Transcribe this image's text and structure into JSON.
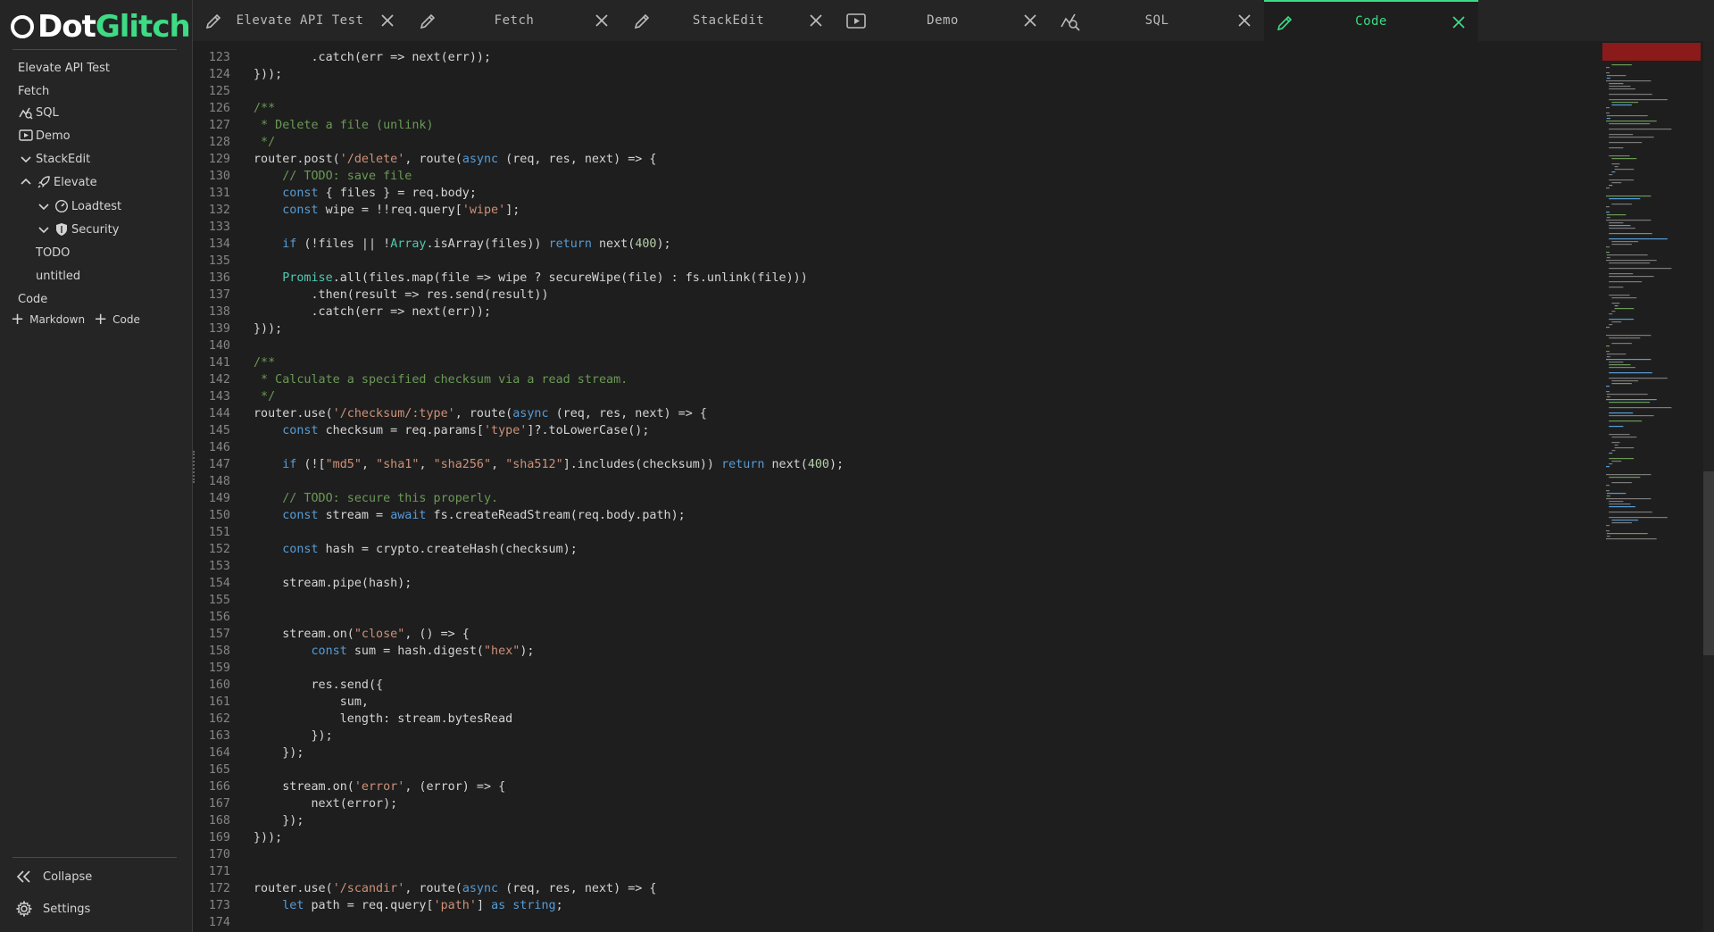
{
  "app": {
    "logo_part1": "Dot",
    "logo_part2": "Glitch"
  },
  "colors": {
    "accent": "#3ddc84",
    "background": "#1e1e1e",
    "sidebar": "#252526"
  },
  "sidebar": {
    "items": [
      {
        "label": "Elevate API Test",
        "icon": "none"
      },
      {
        "label": "Fetch",
        "icon": "none"
      },
      {
        "label": "SQL",
        "icon": "sql-graph-icon"
      },
      {
        "label": "Demo",
        "icon": "play-icon"
      },
      {
        "label": "StackEdit",
        "icon": "chevron-down-icon"
      },
      {
        "label": "Elevate",
        "icon": "rocket-icon"
      },
      {
        "label": "Loadtest",
        "icon": "gauge-icon"
      },
      {
        "label": "Security",
        "icon": "shield-icon"
      },
      {
        "label": "TODO",
        "icon": "none"
      },
      {
        "label": "untitled",
        "icon": "none"
      },
      {
        "label": "Code",
        "icon": "none"
      }
    ],
    "add_markdown": "Markdown",
    "add_code": "Code",
    "collapse": "Collapse",
    "settings": "Settings"
  },
  "tabs": [
    {
      "label": "Elevate API Test",
      "icon": "pencil-icon",
      "active": false
    },
    {
      "label": "Fetch",
      "icon": "pencil-icon",
      "active": false
    },
    {
      "label": "StackEdit",
      "icon": "pencil-icon",
      "active": false
    },
    {
      "label": "Demo",
      "icon": "play-icon",
      "active": false
    },
    {
      "label": "SQL",
      "icon": "sql-graph-icon",
      "active": false
    },
    {
      "label": "Code",
      "icon": "pencil-icon",
      "active": true
    }
  ],
  "editor": {
    "lines": [
      {
        "n": "123",
        "t": "        .catch(err => next(err));"
      },
      {
        "n": "124",
        "t": "}));"
      },
      {
        "n": "125",
        "t": ""
      },
      {
        "n": "126",
        "t": "/**"
      },
      {
        "n": "127",
        "t": " * Delete a file (unlink)"
      },
      {
        "n": "128",
        "t": " */"
      },
      {
        "n": "129",
        "t": "router.post('/delete', route(async (req, res, next) => {"
      },
      {
        "n": "130",
        "t": "    // TODO: save file"
      },
      {
        "n": "131",
        "t": "    const { files } = req.body;"
      },
      {
        "n": "132",
        "t": "    const wipe = !!req.query['wipe'];"
      },
      {
        "n": "133",
        "t": ""
      },
      {
        "n": "134",
        "t": "    if (!files || !Array.isArray(files)) return next(400);"
      },
      {
        "n": "135",
        "t": ""
      },
      {
        "n": "136",
        "t": "    Promise.all(files.map(file => wipe ? secureWipe(file) : fs.unlink(file)))"
      },
      {
        "n": "137",
        "t": "        .then(result => res.send(result))"
      },
      {
        "n": "138",
        "t": "        .catch(err => next(err));"
      },
      {
        "n": "139",
        "t": "}));"
      },
      {
        "n": "140",
        "t": ""
      },
      {
        "n": "141",
        "t": "/**"
      },
      {
        "n": "142",
        "t": " * Calculate a specified checksum via a read stream."
      },
      {
        "n": "143",
        "t": " */"
      },
      {
        "n": "144",
        "t": "router.use('/checksum/:type', route(async (req, res, next) => {"
      },
      {
        "n": "145",
        "t": "    const checksum = req.params['type']?.toLowerCase();"
      },
      {
        "n": "146",
        "t": ""
      },
      {
        "n": "147",
        "t": "    if (![\"md5\", \"sha1\", \"sha256\", \"sha512\"].includes(checksum)) return next(400);"
      },
      {
        "n": "148",
        "t": ""
      },
      {
        "n": "149",
        "t": "    // TODO: secure this properly."
      },
      {
        "n": "150",
        "t": "    const stream = await fs.createReadStream(req.body.path);"
      },
      {
        "n": "151",
        "t": ""
      },
      {
        "n": "152",
        "t": "    const hash = crypto.createHash(checksum);"
      },
      {
        "n": "153",
        "t": ""
      },
      {
        "n": "154",
        "t": "    stream.pipe(hash);"
      },
      {
        "n": "155",
        "t": ""
      },
      {
        "n": "156",
        "t": ""
      },
      {
        "n": "157",
        "t": "    stream.on(\"close\", () => {"
      },
      {
        "n": "158",
        "t": "        const sum = hash.digest(\"hex\");"
      },
      {
        "n": "159",
        "t": ""
      },
      {
        "n": "160",
        "t": "        res.send({"
      },
      {
        "n": "161",
        "t": "            sum,"
      },
      {
        "n": "162",
        "t": "            length: stream.bytesRead"
      },
      {
        "n": "163",
        "t": "        });"
      },
      {
        "n": "164",
        "t": "    });"
      },
      {
        "n": "165",
        "t": ""
      },
      {
        "n": "166",
        "t": "    stream.on('error', (error) => {"
      },
      {
        "n": "167",
        "t": "        next(error);"
      },
      {
        "n": "168",
        "t": "    });"
      },
      {
        "n": "169",
        "t": "}));"
      },
      {
        "n": "170",
        "t": ""
      },
      {
        "n": "171",
        "t": ""
      },
      {
        "n": "172",
        "t": "router.use('/scandir', route(async (req, res, next) => {"
      },
      {
        "n": "173",
        "t": "    let path = req.query['path'] as string;"
      },
      {
        "n": "174",
        "t": ""
      }
    ]
  }
}
